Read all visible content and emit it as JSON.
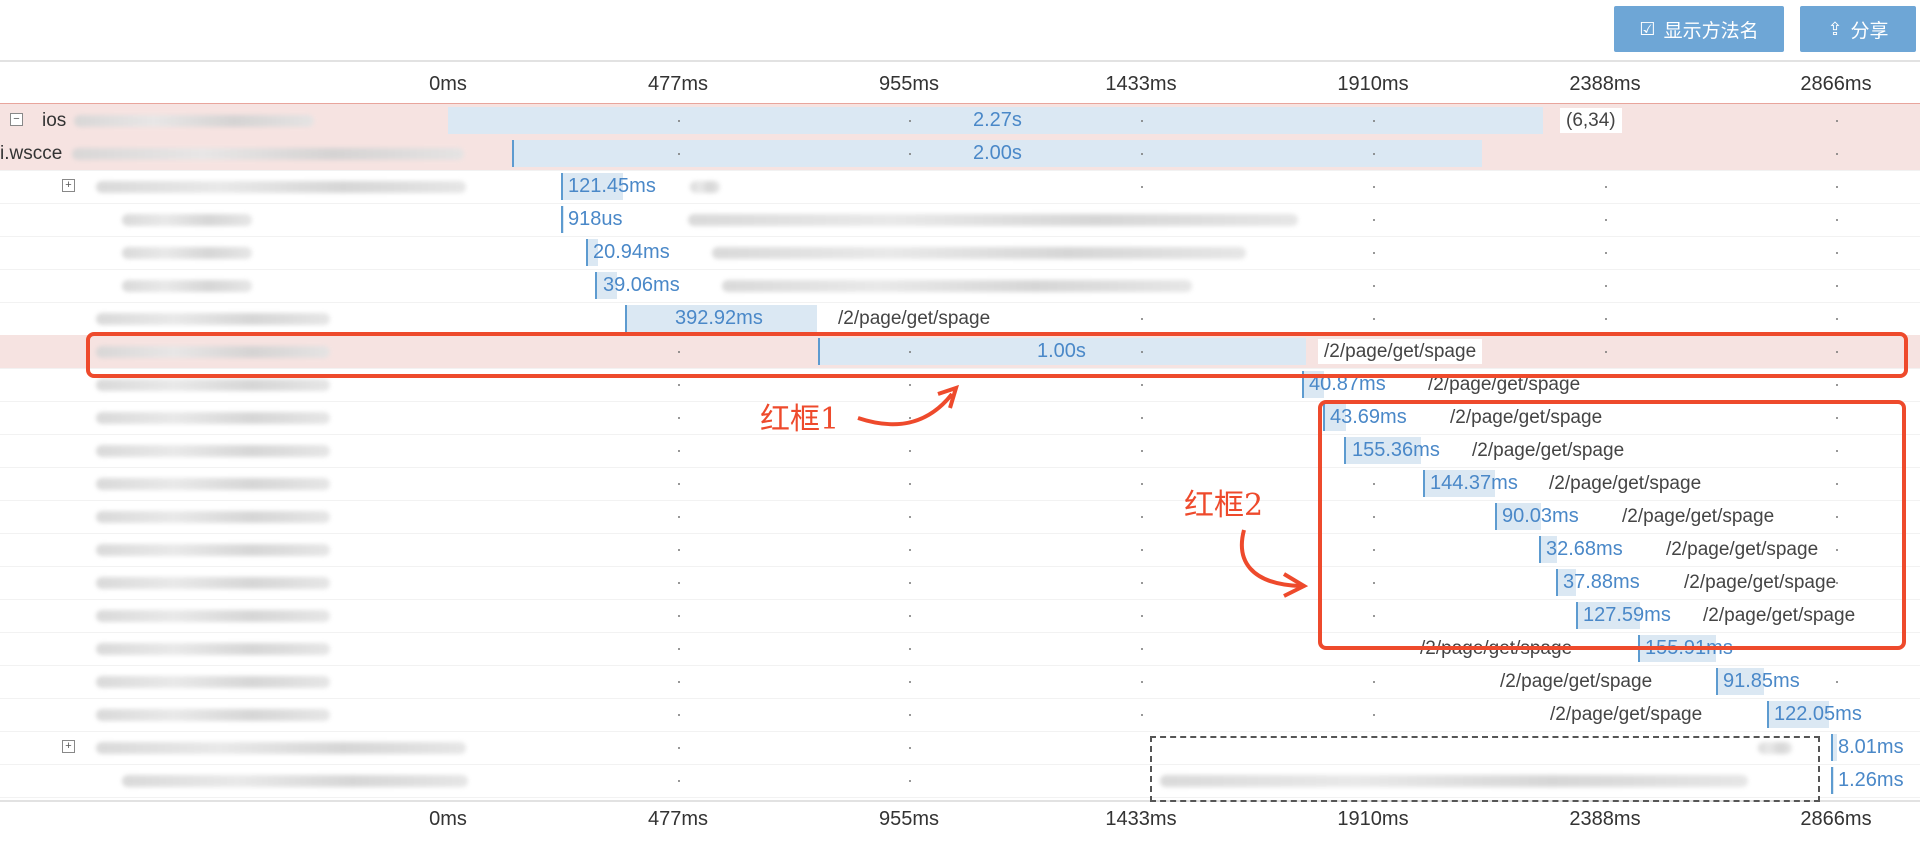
{
  "toolbar": {
    "show_method_label": "显示方法名",
    "share_label": "分享"
  },
  "axis_ticks": [
    "0ms",
    "477ms",
    "955ms",
    "1433ms",
    "1910ms",
    "2388ms",
    "2866ms"
  ],
  "rows": [
    {
      "name": "ios",
      "duration": "2.27s",
      "path": "(6,34)",
      "toggle": "minus"
    },
    {
      "name": "i.wscce",
      "duration": "2.00s",
      "path": ""
    },
    {
      "name": "",
      "duration": "121.45ms",
      "path": "",
      "toggle": "plus"
    },
    {
      "name": "",
      "duration": "918us",
      "path": ""
    },
    {
      "name": "",
      "duration": "20.94ms",
      "path": ""
    },
    {
      "name": "",
      "duration": "39.06ms",
      "path": ""
    },
    {
      "name": "",
      "duration": "392.92ms",
      "path": "/2/page/get/spage"
    },
    {
      "name": "",
      "duration": "1.00s",
      "path": "/2/page/get/spage"
    },
    {
      "name": "",
      "duration": "40.87ms",
      "path": "/2/page/get/spage"
    },
    {
      "name": "",
      "duration": "43.69ms",
      "path": "/2/page/get/spage"
    },
    {
      "name": "",
      "duration": "155.36ms",
      "path": "/2/page/get/spage"
    },
    {
      "name": "",
      "duration": "144.37ms",
      "path": "/2/page/get/spage"
    },
    {
      "name": "",
      "duration": "90.03ms",
      "path": "/2/page/get/spage"
    },
    {
      "name": "",
      "duration": "32.68ms",
      "path": "/2/page/get/spage"
    },
    {
      "name": "",
      "duration": "37.88ms",
      "path": "/2/page/get/spage"
    },
    {
      "name": "",
      "duration": "127.59ms",
      "path": "/2/page/get/spage"
    },
    {
      "name": "",
      "duration": "155.91ms",
      "path": "/2/page/get/spage"
    },
    {
      "name": "",
      "duration": "91.85ms",
      "path": "/2/page/get/spage"
    },
    {
      "name": "",
      "duration": "122.05ms",
      "path": "/2/page/get/spage"
    },
    {
      "name": "",
      "duration": "8.01ms",
      "path": "",
      "toggle": "plus"
    },
    {
      "name": "",
      "duration": "1.26ms",
      "path": ""
    }
  ],
  "annotations": {
    "box1_label": "红框1",
    "box2_label": "红框2"
  },
  "colors": {
    "accent": "#6ea6d6",
    "bar_fill": "#dbe8f3",
    "bar_edge": "#5d9bd0",
    "duration_text": "#4a88c8",
    "highlight": "#ee4a2c"
  }
}
